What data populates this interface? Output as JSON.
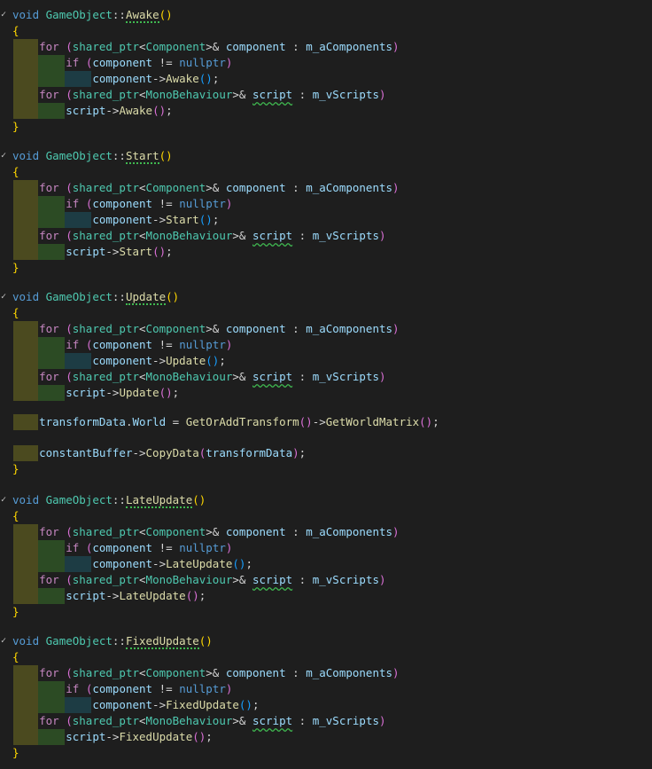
{
  "editor": {
    "class_name": "GameObject",
    "keywords": {
      "void": "void",
      "for": "for",
      "if": "if",
      "nullptr": "nullptr",
      "shared_ptr": "shared_ptr",
      "component_type": "Component",
      "mono_type": "MonoBehaviour"
    },
    "vars": {
      "component": "component",
      "script": "script",
      "components_member": "m_aComponents",
      "scripts_member": "m_vScripts"
    },
    "methods": [
      {
        "name": "Awake"
      },
      {
        "name": "Start"
      },
      {
        "name": "Update"
      },
      {
        "name": "LateUpdate"
      },
      {
        "name": "FixedUpdate"
      }
    ],
    "update_extra": {
      "transform_data": "transformData",
      "world": "World",
      "get_or_add": "GetOrAddTransform",
      "get_world_matrix": "GetWorldMatrix",
      "constant_buffer": "constantBuffer",
      "copy_data": "CopyData"
    },
    "colors": {
      "background": "#1e1e1e",
      "keyword": "#569cd6",
      "control": "#c586c0",
      "type": "#4ec9b0",
      "function": "#dcdcaa",
      "variable": "#9cdcfe",
      "bracket_gold": "#ffd700",
      "bracket_orchid": "#da70d6",
      "bracket_blue": "#179fff",
      "indent_olive": "#4b4a1f",
      "indent_teal": "#1d3c44",
      "indent_green": "#2c4b24"
    }
  }
}
